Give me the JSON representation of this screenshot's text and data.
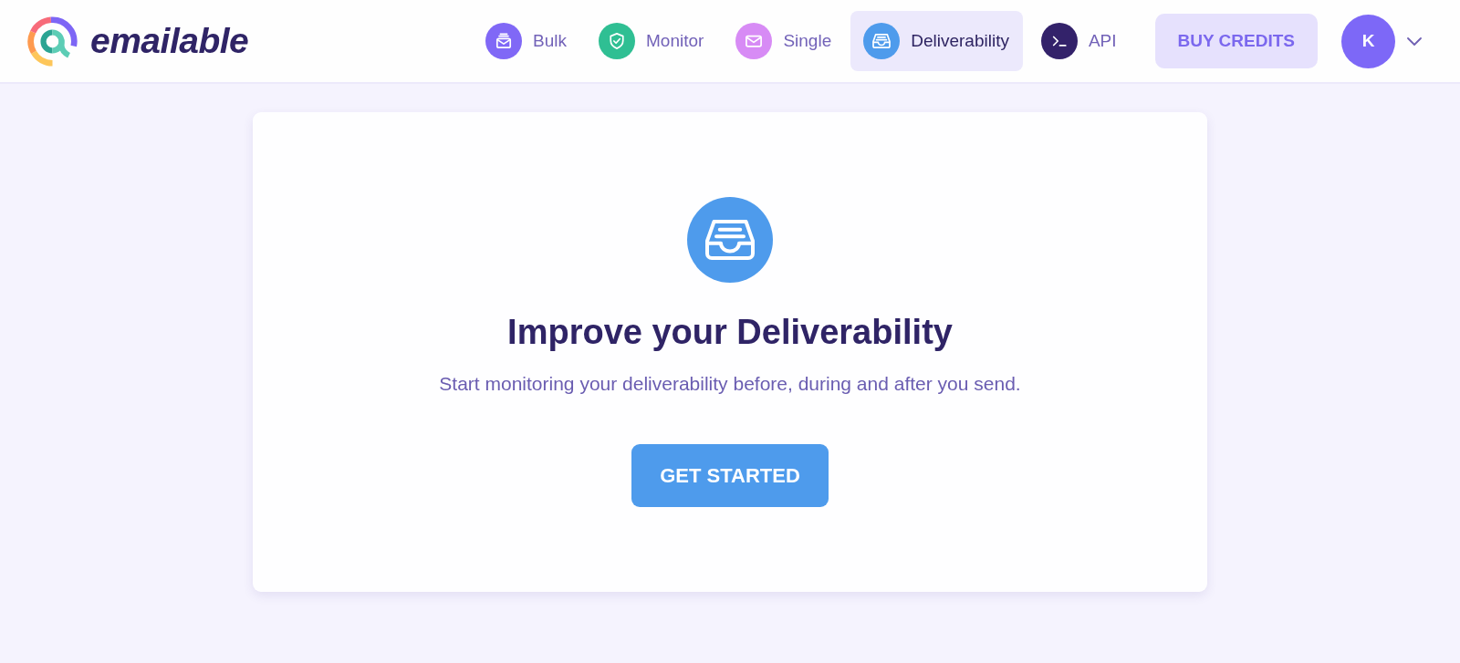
{
  "header": {
    "logo": {
      "text": "emailable"
    },
    "nav": [
      {
        "label": "Bulk",
        "kind": "stack",
        "color": "#8068f6",
        "selected": false
      },
      {
        "label": "Monitor",
        "kind": "shield",
        "color": "#2fbf93",
        "selected": false
      },
      {
        "label": "Single",
        "kind": "envelope",
        "color": "#d78bf5",
        "selected": false
      },
      {
        "label": "Deliverability",
        "kind": "tray",
        "color": "#4e9bec",
        "selected": true
      },
      {
        "label": "API",
        "kind": "terminal",
        "color": "#33226a",
        "selected": false
      }
    ],
    "buy_button": {
      "label": "BUY CREDITS"
    },
    "user_menu": {
      "initial": "K"
    }
  },
  "card": {
    "title": "Improve your Deliverability",
    "subtitle": "Start monitoring your deliverability before, during and after you send.",
    "button": {
      "label": "GET STARTED"
    }
  }
}
